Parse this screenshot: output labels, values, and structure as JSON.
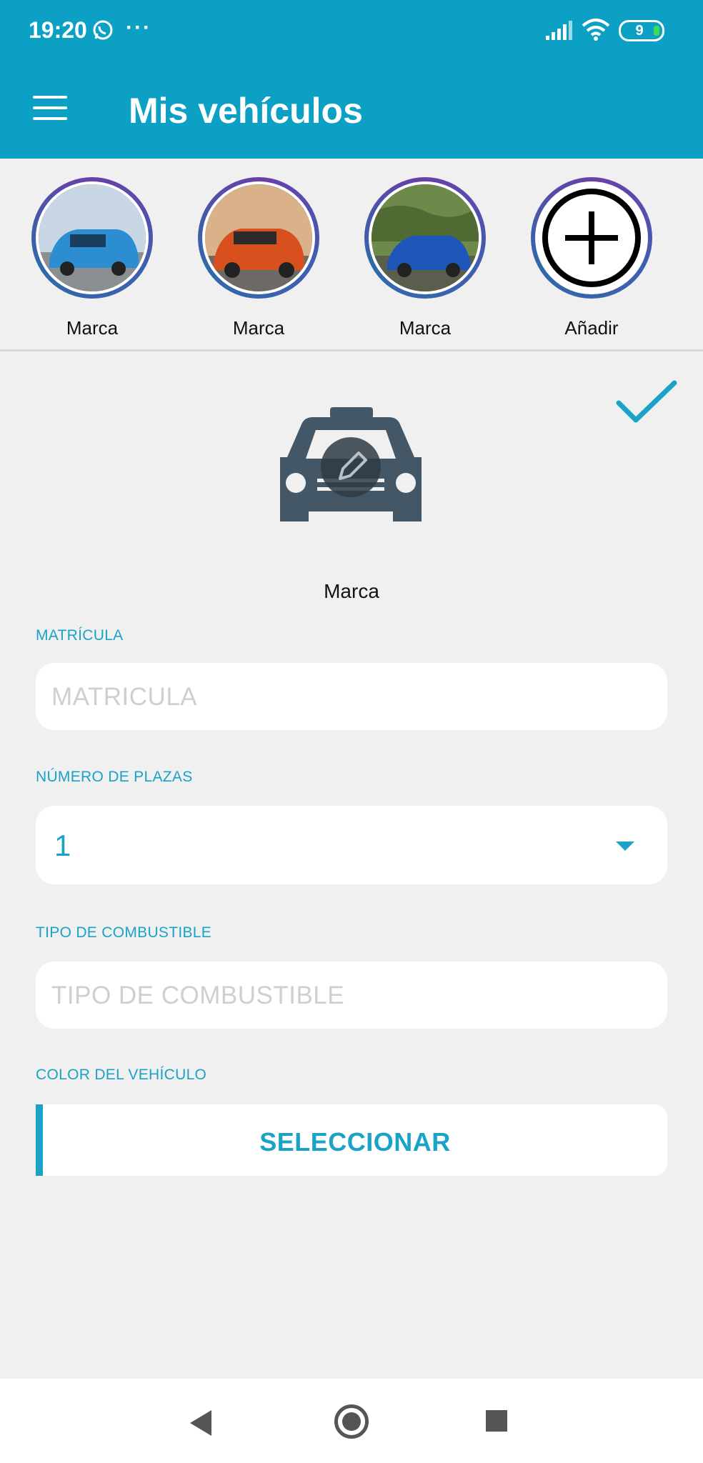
{
  "status_bar": {
    "time": "19:20",
    "more": "···",
    "battery_level": "9"
  },
  "app_bar": {
    "title": "Mis vehículos",
    "menu_icon": "menu-icon"
  },
  "vehicles": [
    {
      "label": "Marca",
      "thumb_color": "#2c8ed0"
    },
    {
      "label": "Marca",
      "thumb_color": "#d8501e"
    },
    {
      "label": "Marca",
      "thumb_color": "#1e55b8"
    }
  ],
  "add_vehicle": {
    "label": "Añadir"
  },
  "form": {
    "brand": "Marca",
    "matricula": {
      "label": "MATRÍCULA",
      "placeholder": "MATRICULA"
    },
    "plazas": {
      "label": "NÚMERO DE PLAZAS",
      "value": "1"
    },
    "combustible": {
      "label": "TIPO DE COMBUSTIBLE",
      "placeholder": "TIPO DE COMBUSTIBLE"
    },
    "color": {
      "label": "COLOR DEL VEHÍCULO",
      "button": "SELECCIONAR"
    }
  },
  "colors": {
    "accent": "#0ba0c4",
    "field_text": "#1aa3c6",
    "background": "#f0f0f1"
  }
}
